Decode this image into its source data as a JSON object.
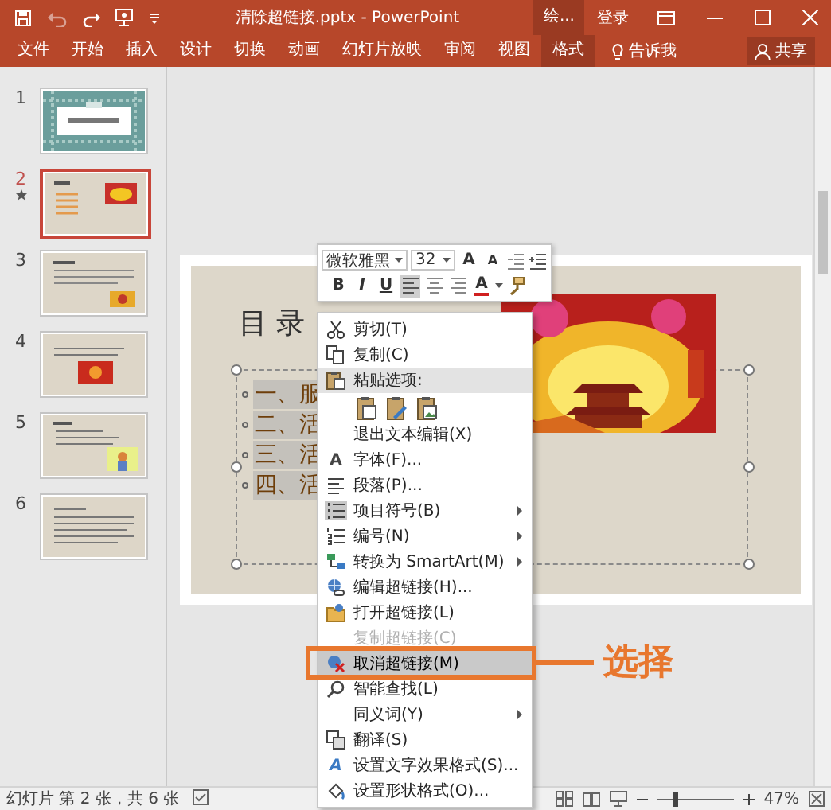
{
  "title_bar": {
    "title": "清除超链接.pptx - PowerPoint",
    "tool_tab": "绘...",
    "sign_in": "登录"
  },
  "ribbon": {
    "tabs": [
      {
        "label": "文件",
        "selected": false
      },
      {
        "label": "开始",
        "selected": false
      },
      {
        "label": "插入",
        "selected": false
      },
      {
        "label": "设计",
        "selected": false
      },
      {
        "label": "切换",
        "selected": false
      },
      {
        "label": "动画",
        "selected": false
      },
      {
        "label": "幻灯片放映",
        "selected": false
      },
      {
        "label": "审阅",
        "selected": false
      },
      {
        "label": "视图",
        "selected": false
      },
      {
        "label": "格式",
        "selected": true
      }
    ],
    "tell_me": "告诉我",
    "share": "共享"
  },
  "thumbnails": [
    {
      "number": "1",
      "kind": "cover",
      "selected": false,
      "animated": false
    },
    {
      "number": "2",
      "kind": "agenda",
      "selected": true,
      "animated": true
    },
    {
      "number": "3",
      "kind": "text-photo-right",
      "selected": false,
      "animated": false
    },
    {
      "number": "4",
      "kind": "text-photo-center",
      "selected": false,
      "animated": false
    },
    {
      "number": "5",
      "kind": "text-cartoon",
      "selected": false,
      "animated": false
    },
    {
      "number": "6",
      "kind": "text-only",
      "selected": false,
      "animated": false
    }
  ],
  "slide": {
    "title": "目 录",
    "lines": [
      {
        "text": "一、服",
        "selected": true
      },
      {
        "text": "二、活",
        "selected": true
      },
      {
        "text": "三、活",
        "selected": true
      },
      {
        "text": "四、活",
        "selected": true
      }
    ]
  },
  "mini_toolbar": {
    "font": "微软雅黑",
    "size": "32",
    "grow": "A",
    "shrink": "A",
    "bold": "B",
    "italic": "I",
    "underline": "U",
    "font_color": "A",
    "alignment": [
      {
        "kind": "left",
        "selected": true
      },
      {
        "kind": "center",
        "selected": false
      },
      {
        "kind": "right",
        "selected": false
      }
    ]
  },
  "context_menu": [
    {
      "kind": "item",
      "label": "剪切(T)",
      "disabled": false,
      "selected": false,
      "submenu": false
    },
    {
      "kind": "item",
      "label": "复制(C)",
      "disabled": false,
      "selected": false,
      "submenu": false
    },
    {
      "kind": "header",
      "label": "粘贴选项:"
    },
    {
      "kind": "paste-options"
    },
    {
      "kind": "item",
      "label": "退出文本编辑(X)",
      "disabled": false,
      "selected": false,
      "submenu": false
    },
    {
      "kind": "item",
      "label": "字体(F)...",
      "glyph": "A",
      "disabled": false,
      "selected": false,
      "submenu": false
    },
    {
      "kind": "item",
      "label": "段落(P)...",
      "disabled": false,
      "selected": false,
      "submenu": false
    },
    {
      "kind": "item",
      "label": "项目符号(B)",
      "disabled": false,
      "selected": false,
      "submenu": true
    },
    {
      "kind": "item",
      "label": "编号(N)",
      "disabled": false,
      "selected": false,
      "submenu": true
    },
    {
      "kind": "item",
      "label": "转换为 SmartArt(M)",
      "disabled": false,
      "selected": false,
      "submenu": true
    },
    {
      "kind": "item",
      "label": "编辑超链接(H)...",
      "disabled": false,
      "selected": false,
      "submenu": false
    },
    {
      "kind": "item",
      "label": "打开超链接(L)",
      "disabled": false,
      "selected": false,
      "submenu": false
    },
    {
      "kind": "item",
      "label": "复制超链接(C)",
      "disabled": true,
      "selected": false,
      "submenu": false
    },
    {
      "kind": "item",
      "label": "取消超链接(M)",
      "disabled": false,
      "selected": true,
      "submenu": false
    },
    {
      "kind": "item",
      "label": "智能查找(L)",
      "disabled": false,
      "selected": false,
      "submenu": false
    },
    {
      "kind": "item",
      "label": "同义词(Y)",
      "disabled": false,
      "selected": false,
      "submenu": true
    },
    {
      "kind": "item",
      "label": "翻译(S)",
      "disabled": false,
      "selected": false,
      "submenu": false
    },
    {
      "kind": "item",
      "label": "设置文字效果格式(S)...",
      "glyph": "A",
      "disabled": false,
      "selected": false,
      "submenu": false
    },
    {
      "kind": "item",
      "label": "设置形状格式(O)...",
      "disabled": false,
      "selected": false,
      "submenu": false
    }
  ],
  "callout": {
    "text": "选择"
  },
  "status_bar": {
    "slide_info": "幻灯片 第 2 张，共 6 张",
    "zoom": "47%",
    "zoom_slider": {
      "level": 0.23
    }
  }
}
